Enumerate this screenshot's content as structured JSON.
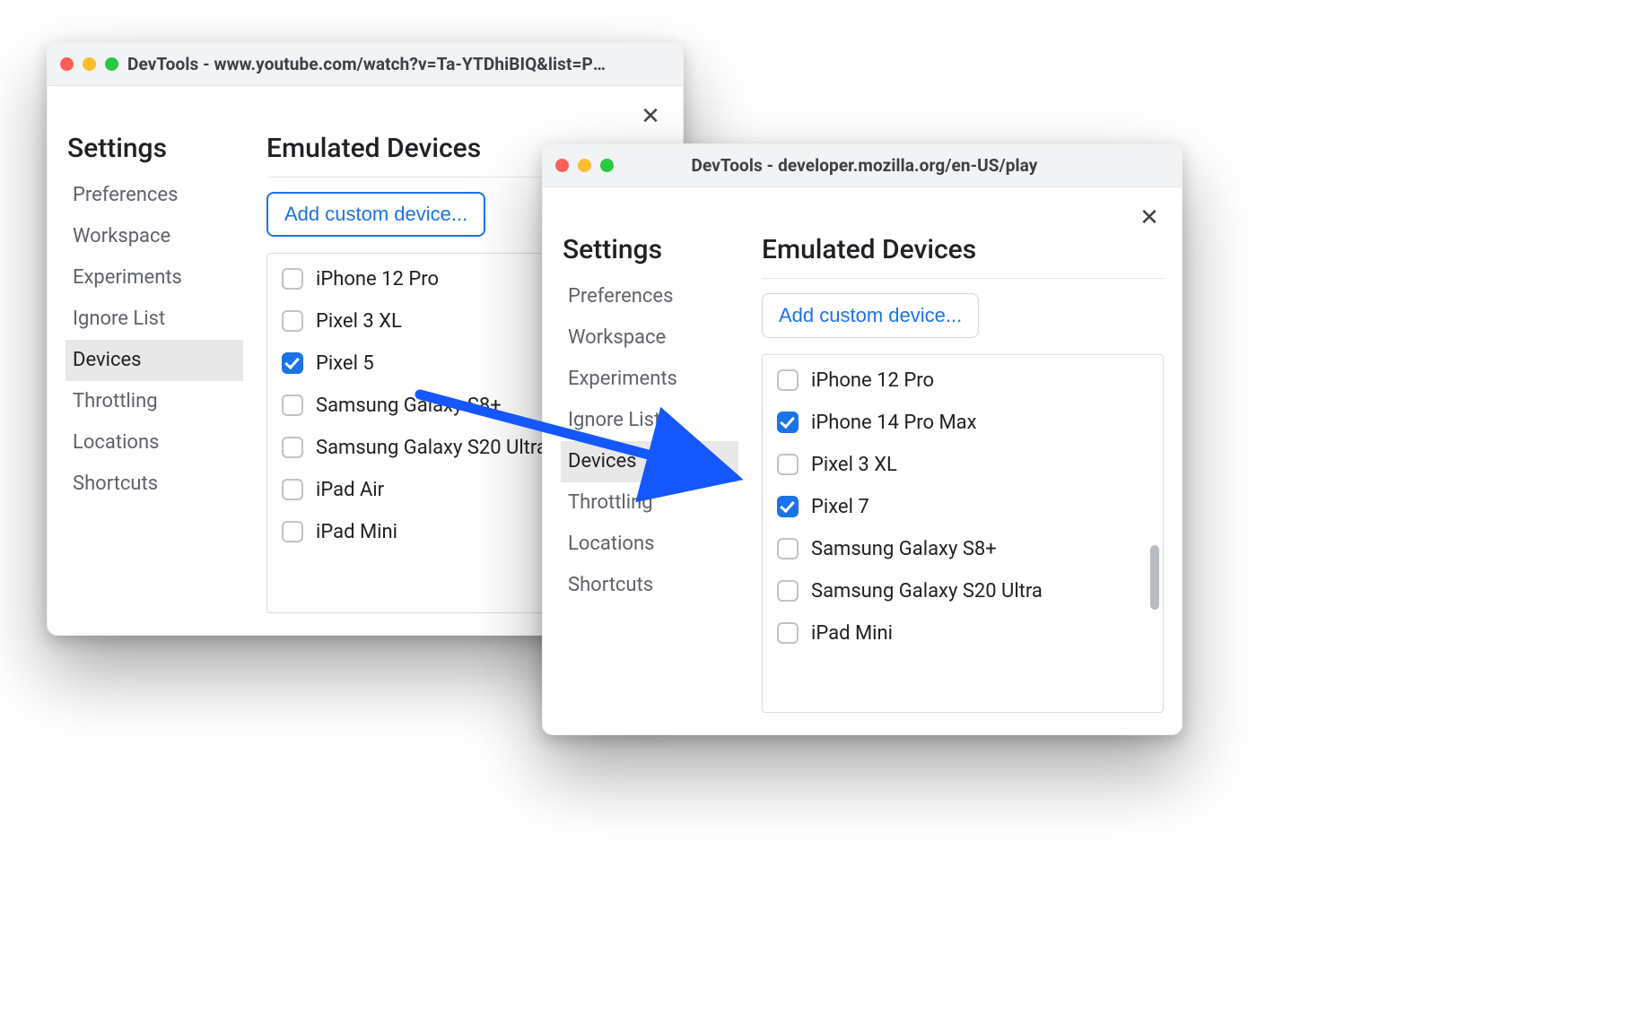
{
  "windows": {
    "a": {
      "title": "DevTools - www.youtube.com/watch?v=Ta-YTDhiBIQ&list=PL...",
      "settings_heading": "Settings",
      "main_heading": "Emulated Devices",
      "add_button": "Add custom device...",
      "sidebar": [
        {
          "label": "Preferences",
          "selected": false
        },
        {
          "label": "Workspace",
          "selected": false
        },
        {
          "label": "Experiments",
          "selected": false
        },
        {
          "label": "Ignore List",
          "selected": false
        },
        {
          "label": "Devices",
          "selected": true
        },
        {
          "label": "Throttling",
          "selected": false
        },
        {
          "label": "Locations",
          "selected": false
        },
        {
          "label": "Shortcuts",
          "selected": false
        }
      ],
      "devices": [
        {
          "label": "iPhone 12 Pro",
          "checked": false
        },
        {
          "label": "Pixel 3 XL",
          "checked": false
        },
        {
          "label": "Pixel 5",
          "checked": true
        },
        {
          "label": "Samsung Galaxy S8+",
          "checked": false
        },
        {
          "label": "Samsung Galaxy S20 Ultra",
          "checked": false
        },
        {
          "label": "iPad Air",
          "checked": false
        },
        {
          "label": "iPad Mini",
          "checked": false
        }
      ]
    },
    "b": {
      "title": "DevTools - developer.mozilla.org/en-US/play",
      "settings_heading": "Settings",
      "main_heading": "Emulated Devices",
      "add_button": "Add custom device...",
      "sidebar": [
        {
          "label": "Preferences",
          "selected": false
        },
        {
          "label": "Workspace",
          "selected": false
        },
        {
          "label": "Experiments",
          "selected": false
        },
        {
          "label": "Ignore List",
          "selected": false
        },
        {
          "label": "Devices",
          "selected": true
        },
        {
          "label": "Throttling",
          "selected": false
        },
        {
          "label": "Locations",
          "selected": false
        },
        {
          "label": "Shortcuts",
          "selected": false
        }
      ],
      "devices": [
        {
          "label": "iPhone 12 Pro",
          "checked": false
        },
        {
          "label": "iPhone 14 Pro Max",
          "checked": true
        },
        {
          "label": "Pixel 3 XL",
          "checked": false
        },
        {
          "label": "Pixel 7",
          "checked": true
        },
        {
          "label": "Samsung Galaxy S8+",
          "checked": false
        },
        {
          "label": "Samsung Galaxy S20 Ultra",
          "checked": false
        },
        {
          "label": "iPad Mini",
          "checked": false
        }
      ]
    }
  },
  "colors": {
    "blue": "#1a73e8",
    "arrow": "#1557ff"
  }
}
